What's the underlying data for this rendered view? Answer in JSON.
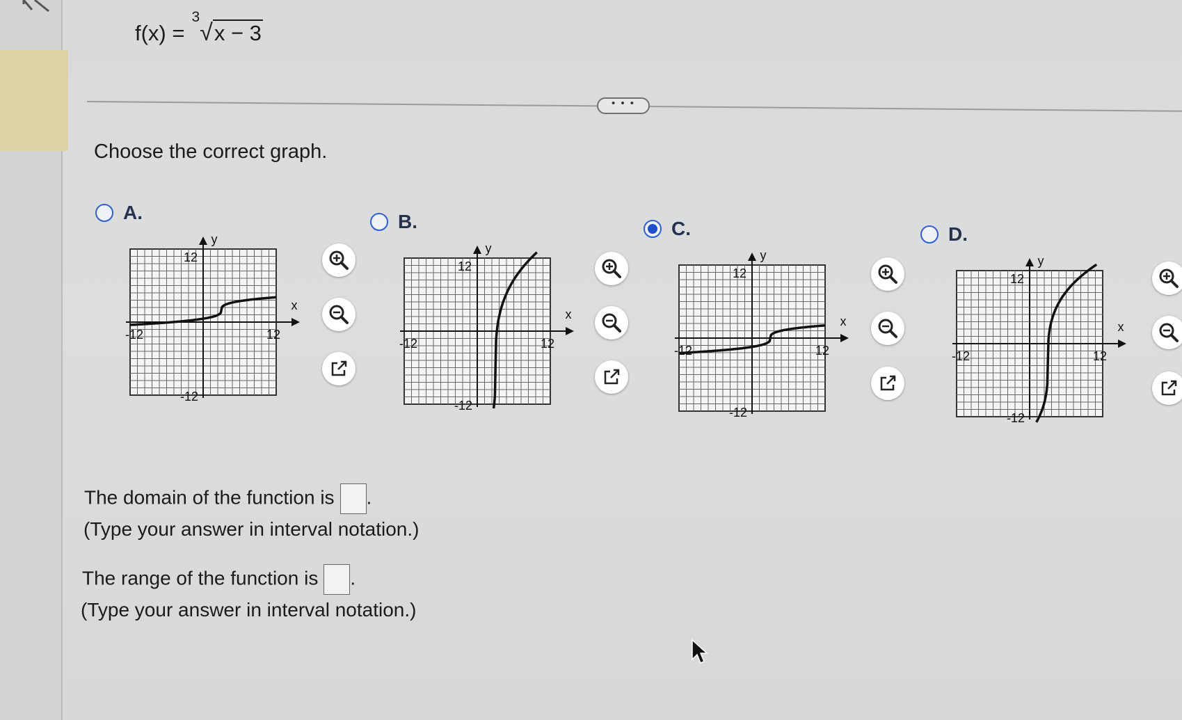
{
  "problem": {
    "func_name": "f(x) =",
    "root_index": "3",
    "radicand": "x − 3"
  },
  "more_button": "• • •",
  "prompt": "Choose the correct graph.",
  "options": [
    {
      "letter": "A.",
      "selected": false,
      "graph": {
        "x_min": "-12",
        "x_max": "12",
        "y_max": "12",
        "y_min": "-12",
        "x_axis_label": "x",
        "y_axis_label": "y"
      }
    },
    {
      "letter": "B.",
      "selected": false,
      "graph": {
        "x_min": "-12",
        "x_max": "12",
        "y_max": "12",
        "y_min": "-12",
        "x_axis_label": "x",
        "y_axis_label": "y"
      }
    },
    {
      "letter": "C.",
      "selected": true,
      "graph": {
        "x_min": "-12",
        "x_max": "12",
        "y_max": "12",
        "y_min": "-12",
        "x_axis_label": "x",
        "y_axis_label": "y"
      }
    },
    {
      "letter": "D.",
      "selected": false,
      "graph": {
        "x_min": "-12",
        "x_max": "12",
        "y_max": "12",
        "y_min": "-12",
        "x_axis_label": "x",
        "y_axis_label": "y"
      }
    }
  ],
  "tools": [
    "zoom-in-icon",
    "zoom-out-icon",
    "popout-icon"
  ],
  "domain_question": {
    "text": "The domain of the function is",
    "hint": "(Type your answer in interval notation.)",
    "value": ""
  },
  "range_question": {
    "text": "The range of the function is",
    "hint": "(Type your answer in interval notation.)",
    "value": ""
  },
  "colors": {
    "radio_accent": "#1d4fc9",
    "grid": "#555555",
    "curve": "#111111"
  }
}
